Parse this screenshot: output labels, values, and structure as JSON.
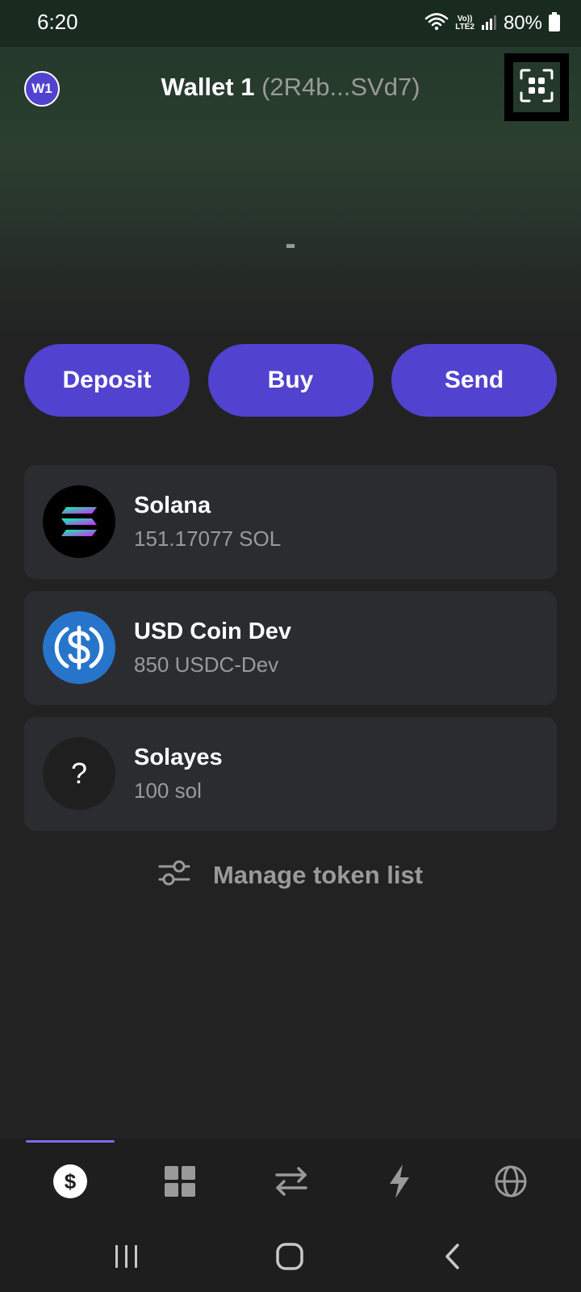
{
  "status_bar": {
    "time": "6:20",
    "network_top": "Vo))",
    "network_bottom": "LTE2",
    "battery": "80%"
  },
  "header": {
    "avatar": "W1",
    "wallet_name": "Wallet 1",
    "wallet_address": "(2R4b...SVd7)",
    "scan_icon": "qr-scan-icon"
  },
  "balance": {
    "value": "-"
  },
  "actions": [
    {
      "label": "Deposit"
    },
    {
      "label": "Buy"
    },
    {
      "label": "Send"
    }
  ],
  "tokens": [
    {
      "name": "Solana",
      "amount": "151.17077 SOL",
      "icon": "solana-logo-icon"
    },
    {
      "name": "USD Coin Dev",
      "amount": "850 USDC-Dev",
      "icon": "usdc-logo-icon"
    },
    {
      "name": "Solayes",
      "amount": "100 sol",
      "icon": "unknown-token-icon",
      "icon_glyph": "?"
    }
  ],
  "manage": {
    "label": "Manage token list",
    "icon": "sliders-icon"
  },
  "tab_bar": {
    "active_index": 0,
    "tabs": [
      {
        "icon": "dollar-icon"
      },
      {
        "icon": "grid-icon"
      },
      {
        "icon": "swap-arrows-icon"
      },
      {
        "icon": "lightning-icon"
      },
      {
        "icon": "globe-icon"
      }
    ]
  },
  "colors": {
    "accent": "#5142cf",
    "card": "#2b2c30",
    "muted_text": "#9a9a9a"
  }
}
